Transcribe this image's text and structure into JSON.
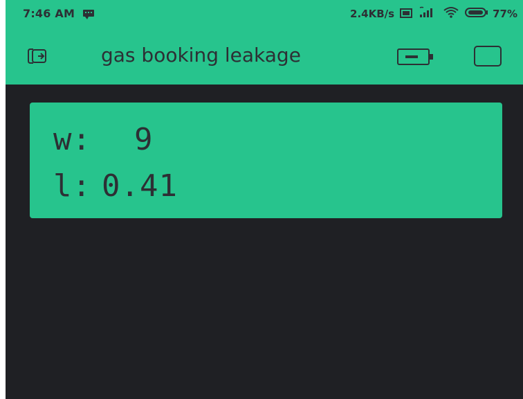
{
  "status_bar": {
    "time": "7:46 AM",
    "network_speed": "2.4KB/s",
    "battery": "77%"
  },
  "app_bar": {
    "title": "gas booking leakage",
    "exit_icon": "exit-icon",
    "device_icon": "device-icon",
    "square_button": "square-button"
  },
  "lcd": {
    "line_1_prefix": "w:",
    "line_1_value": "9",
    "line_2_prefix": "l:",
    "line_2_value": "0.41"
  },
  "colors": {
    "accent": "#27c48d",
    "background": "#1f2024",
    "text": "#2d2f34"
  }
}
